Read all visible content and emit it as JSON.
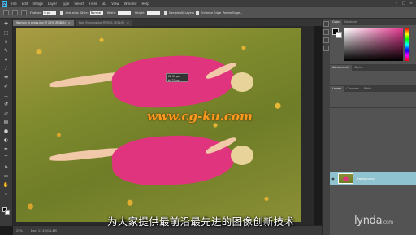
{
  "app": {
    "logo": "Ps"
  },
  "menu": [
    "File",
    "Edit",
    "Image",
    "Layer",
    "Type",
    "Select",
    "Filter",
    "3D",
    "View",
    "Window",
    "Help"
  ],
  "window_buttons": [
    "–",
    "□",
    "×"
  ],
  "options": {
    "feather_label": "Feather:",
    "feather_value": "0 px",
    "antialias_label": "Anti-alias",
    "style_label": "Style:",
    "style_value": "Normal",
    "width_label": "Width:",
    "height_label": "Height:",
    "refine_label": "Refine Edge...",
    "sample_label": "Sample All Layers",
    "enhance_label": "Enhance Edge"
  },
  "doc_tabs": [
    {
      "label": "Woman in grass.jpg @ 25% (RGB/8)",
      "close": "×"
    },
    {
      "label": "Sam Running.jpg @ 50% (RGB/8)",
      "close": "×"
    }
  ],
  "transform_tip": {
    "line1": "W: 56 px",
    "line2": "H: 22 px"
  },
  "watermark": "www.cg-ku.com",
  "subtitle": "为大家提供最前沿最先进的图像创新技术",
  "status": {
    "zoom": "25%",
    "doc": "Doc: 11.4M/11.4M"
  },
  "panels": {
    "color_tabs": [
      "Color",
      "Swatches"
    ],
    "adjust_tabs": [
      "Adjustments",
      "Styles"
    ],
    "layer_tabs": [
      "Layers",
      "Channels",
      "Paths"
    ],
    "layer_name": "Background"
  },
  "brand": {
    "name": "lynda",
    "suffix": ".com"
  },
  "colors": {
    "accent": "#31c5f4",
    "dress": "#e0357e",
    "layer_selected": "#8ec3cf",
    "watermark": "#ff9a1f"
  }
}
